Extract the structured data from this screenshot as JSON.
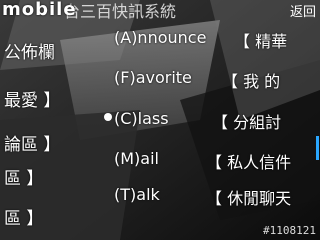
{
  "header": {
    "brand": "mobile",
    "under_text": "台三百快訊系統",
    "back_label": "返回"
  },
  "left_panel": {
    "items": [
      "公佈欄 ",
      "最愛 】",
      "論區 】",
      "區 】",
      "區 】"
    ]
  },
  "menu": {
    "items": [
      {
        "key": "(A)nnounce",
        "desc": "【 精華",
        "selected": false
      },
      {
        "key": "(F)avorite",
        "desc": "【 我 的",
        "selected": false
      },
      {
        "key": "(C)lass",
        "desc": "【 分組討",
        "selected": true
      },
      {
        "key": "(M)ail",
        "desc": "【 私人信件",
        "selected": false
      },
      {
        "key": "(T)alk",
        "desc": "【 休閒聊天",
        "selected": false
      }
    ]
  },
  "footer": {
    "id_text": "#1108121"
  },
  "colors": {
    "background": "#1a1a1a",
    "scrollbar": "#2aa7ff",
    "text": "#ffffff"
  }
}
